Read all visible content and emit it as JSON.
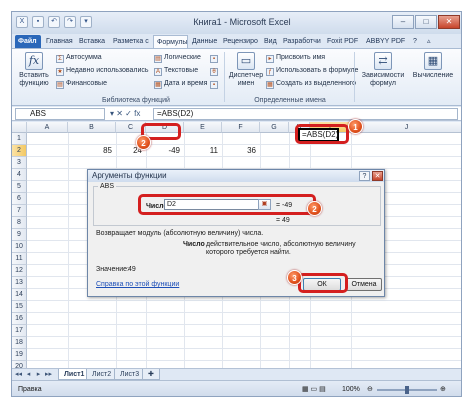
{
  "window": {
    "title": "Книга1 - Microsoft Excel",
    "controls": [
      "–",
      "□",
      "✕"
    ]
  },
  "ribbon_tabs": [
    "Файл",
    "Главная",
    "Вставка",
    "Разметка с",
    "Формулы",
    "Данные",
    "Рецензиро",
    "Вид",
    "Разработчи",
    "Foxit PDF",
    "ABBYY PDF"
  ],
  "ribbon": {
    "insert_function_label": "Вставить функцию",
    "fx_symbol": "fx",
    "library": {
      "col1": [
        "Автосумма",
        "Недавно использовались",
        "Финансовые"
      ],
      "col2": [
        "Логические",
        "Текстовые",
        "Дата и время"
      ],
      "group_label": "Библиотека функций"
    },
    "name_manager_label": "Диспетчер имен",
    "defined_names": {
      "items": [
        "Присвоить имя",
        "Использовать в формуле",
        "Создать из выделенного"
      ],
      "group_label": "Определенные имена"
    },
    "dependencies_label": "Зависимости формул",
    "calculation_label": "Вычисление"
  },
  "formula_bar": {
    "name_box": "ABS",
    "buttons": "▾  ✕  ✓  fx",
    "formula": "=ABS(D2)"
  },
  "sheet": {
    "columns": [
      "A",
      "B",
      "C",
      "D",
      "E",
      "F",
      "G",
      "H",
      "I",
      "J"
    ],
    "rows": [
      "1",
      "2",
      "3",
      "4",
      "5",
      "6",
      "7",
      "8",
      "9",
      "10",
      "11",
      "12",
      "13",
      "14",
      "15",
      "16",
      "17",
      "18",
      "19",
      "20"
    ],
    "row2_values": [
      "85",
      "24",
      "-49",
      "11",
      "36"
    ],
    "active_cell_text": "=ABS(D2)"
  },
  "badges": [
    "1",
    "2",
    "2",
    "3"
  ],
  "dialog": {
    "title": "Аргументы функции",
    "help_button": "?",
    "close_button": "✕",
    "function_name": "ABS",
    "arg_label": "Число",
    "arg_value": "D2",
    "ref_button": "▣",
    "arg_result": "=  -49",
    "total_result": "=  49",
    "description": "Возвращает модуль (абсолютную величину) числа.",
    "param_name": "Число",
    "param_description": "действительное число, абсолютную величину которого требуется найти.",
    "value_label": "Значение:",
    "value": "49",
    "help_link": "Справка по этой функции",
    "ok_button": "ОК",
    "cancel_button": "Отмена"
  },
  "sheet_tabs": [
    "Лист1",
    "Лист2",
    "Лист3"
  ],
  "nav_buttons": [
    "◂◂",
    "◂",
    "▸",
    "▸▸"
  ],
  "status": {
    "mode": "Правка",
    "zoom": "100%"
  },
  "colors": {
    "accent": "#2a67b9",
    "highlight": "#d41f1f",
    "badge": "#e0501c"
  }
}
